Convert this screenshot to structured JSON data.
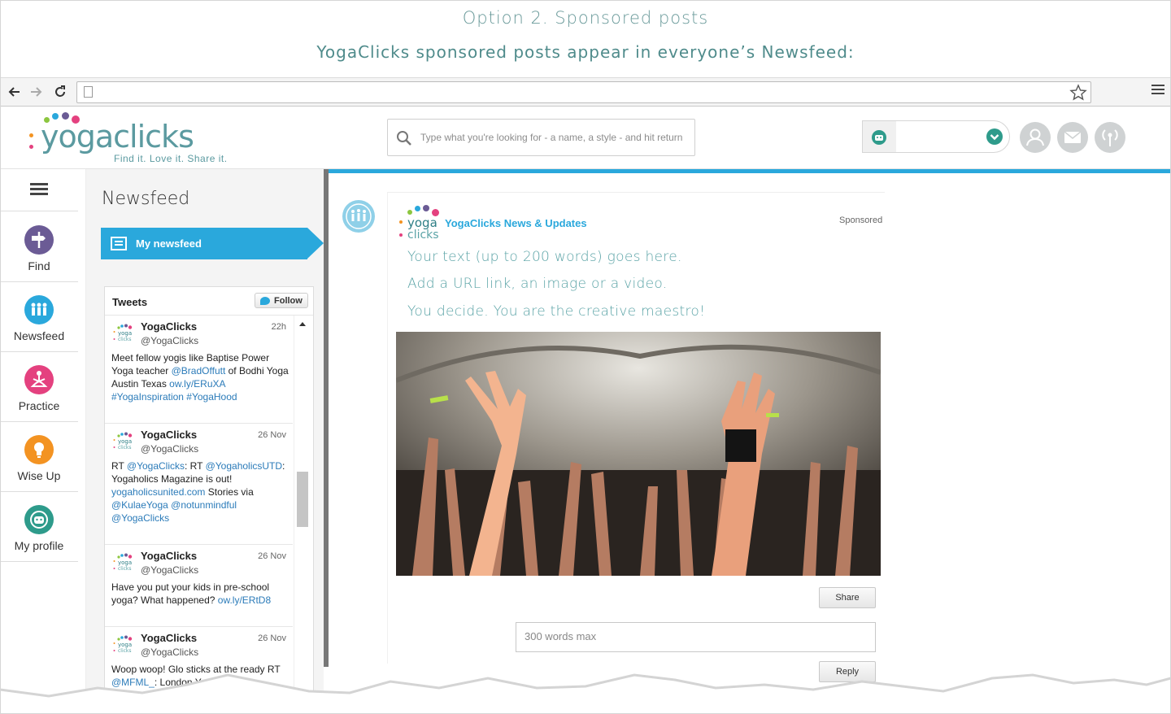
{
  "presentation": {
    "heading": "Option 2. Sponsored posts",
    "subheading": "YogaClicks sponsored posts appear in everyone’s Newsfeed:"
  },
  "browser": {
    "icons": [
      "back-arrow-icon",
      "forward-arrow-icon",
      "reload-icon",
      "page-icon",
      "star-icon",
      "menu-icon"
    ]
  },
  "header": {
    "logo": {
      "word_light": "yoga",
      "word_bold": "clicks",
      "tagline": "Find it. Love it. Share it."
    },
    "search_placeholder": "Type what you're looking for - a name, a style - and hit return",
    "user_select_value": ""
  },
  "sidebar": {
    "items": [
      {
        "label": "Find",
        "color": "#6b5b95",
        "icon": "signpost-icon"
      },
      {
        "label": "Newsfeed",
        "color": "#2aa8dc",
        "icon": "people-icon"
      },
      {
        "label": "Practice",
        "color": "#e4417f",
        "icon": "yoga-pose-icon"
      },
      {
        "label": "Wise Up",
        "color": "#f39322",
        "icon": "lightbulb-icon"
      },
      {
        "label": "My profile",
        "color": "#2e9b8b",
        "icon": "profile-face-icon"
      }
    ]
  },
  "newsfeed": {
    "title": "Newsfeed",
    "tab_label": "My newsfeed"
  },
  "tweets": {
    "title": "Tweets",
    "follow_label": "Follow",
    "items": [
      {
        "name": "YogaClicks",
        "handle": "@YogaClicks",
        "time": "22h",
        "parts": [
          {
            "t": "Meet fellow yogis like Baptise Power Yoga teacher "
          },
          {
            "t": "@BradOffutt",
            "link": true
          },
          {
            "t": " of Bodhi Yoga Austin Texas "
          },
          {
            "t": "ow.ly/ERuXA",
            "link": true
          },
          {
            "t": " "
          },
          {
            "t": "#YogaInspiration #YogaHood",
            "link": true
          }
        ]
      },
      {
        "name": "YogaClicks",
        "handle": "@YogaClicks",
        "time": "26 Nov",
        "parts": [
          {
            "t": "RT "
          },
          {
            "t": "@YogaClicks",
            "link": true
          },
          {
            "t": ": RT "
          },
          {
            "t": "@YogaholicsUTD",
            "link": true
          },
          {
            "t": ": Yogaholics Magazine is out! "
          },
          {
            "t": "yogaholicsunited.com",
            "link": true
          },
          {
            "t": " Stories via "
          },
          {
            "t": "@KulaeYoga",
            "link": true
          },
          {
            "t": " "
          },
          {
            "t": "@notunmindful @YogaClicks",
            "link": true
          }
        ]
      },
      {
        "name": "YogaClicks",
        "handle": "@YogaClicks",
        "time": "26 Nov",
        "parts": [
          {
            "t": "Have you put your kids in pre-school yoga? What happened? "
          },
          {
            "t": "ow.ly/ERtD8",
            "link": true
          }
        ]
      },
      {
        "name": "YogaClicks",
        "handle": "@YogaClicks",
        "time": "26 Nov",
        "parts": [
          {
            "t": "Woop woop! Glo sticks at the ready "
          },
          {
            "t": "RT "
          },
          {
            "t": "@MFML_",
            "link": true
          },
          {
            "t": ": London Y..."
          }
        ]
      }
    ]
  },
  "post": {
    "source": "YogaClicks News & Updates",
    "sponsored_label": "Sponsored",
    "lines": [
      "Your text (up to 200 words) goes here.",
      "Add a URL link, an image or a video.",
      "You decide. You are the creative maestro!"
    ],
    "share_label": "Share",
    "comment_placeholder": "300 words max",
    "reply_label": "Reply"
  },
  "colors": {
    "accent": "#2aa8dc",
    "teal": "#5aa3a6",
    "dot_palette": [
      "#f39322",
      "#2aa8dc",
      "#e4417f",
      "#6b5b95",
      "#8cc63f"
    ]
  }
}
